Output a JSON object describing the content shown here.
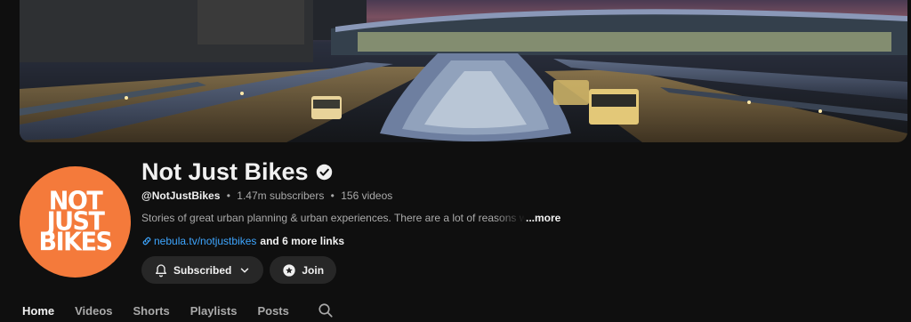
{
  "banner": {
    "alt": "station-at-dusk-banner"
  },
  "avatar": {
    "logo_lines": [
      "NOT",
      "JUST",
      "BIKES"
    ],
    "bg_color": "#f47a3b"
  },
  "channel": {
    "name": "Not Just Bikes",
    "handle": "@NotJustBikes",
    "subscribers": "1.47m subscribers",
    "videos": "156 videos",
    "separator": "•",
    "description": "Stories of great urban planning & urban experiences. There are a lot of reasons why Dutch",
    "more_label": "...more",
    "link_url": "nebula.tv/notjustbikes",
    "more_links": "and 6 more links"
  },
  "actions": {
    "subscribed_label": "Subscribed",
    "join_label": "Join"
  },
  "tabs": [
    {
      "label": "Home",
      "active": true
    },
    {
      "label": "Videos"
    },
    {
      "label": "Shorts"
    },
    {
      "label": "Playlists"
    },
    {
      "label": "Posts"
    }
  ],
  "icons": {
    "verified": "verified-check-icon",
    "link": "link-icon",
    "bell": "bell-icon",
    "chevron": "chevron-down-icon",
    "join": "star-badge-icon",
    "search": "search-icon"
  },
  "colors": {
    "background": "#0f0f0f",
    "link": "#3ea6ff",
    "button_bg": "#272727",
    "muted": "#aaaaaa"
  }
}
